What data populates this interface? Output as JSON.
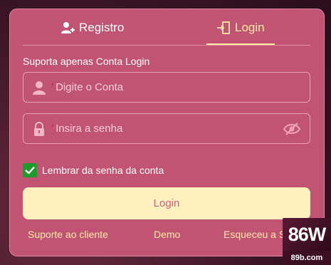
{
  "tabs": {
    "register_label": "Registro",
    "login_label": "Login",
    "active": "login"
  },
  "note": "Suporta apenas Conta Login",
  "account": {
    "placeholder": "Digite o Conta",
    "required_mark": "*",
    "icon": "user-icon"
  },
  "password": {
    "placeholder": "Insira a senha",
    "required_mark": "*",
    "icon": "lock-icon",
    "toggle_icon": "eye-slash-icon"
  },
  "remember": {
    "label": "Lembrar da senha da conta",
    "checked": true
  },
  "login_button": "Login",
  "links": {
    "support": "Suporte ao cliente",
    "demo": "Demo",
    "forgot": "Esqueceu a S"
  },
  "badge": {
    "logo": "86W",
    "domain": "89b.com"
  },
  "colors": {
    "panel": "#c15472",
    "accent": "#ffe8a6",
    "button": "#fff0bf",
    "checkbox": "#1f9a2c"
  }
}
